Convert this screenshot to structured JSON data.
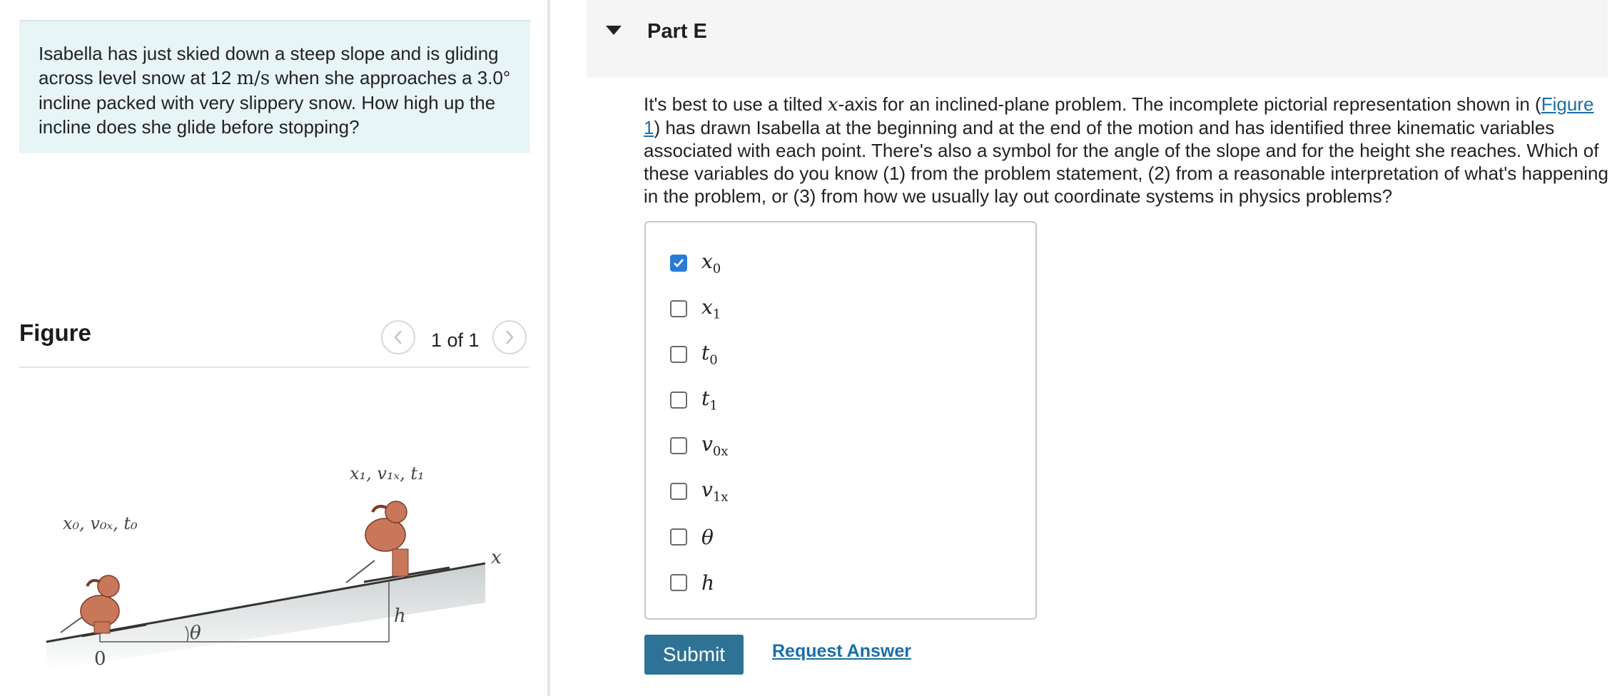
{
  "problem": {
    "text_1": "Isabella has just skied down a steep slope and is gliding across level snow at 12 ",
    "speed_unit": "m/s",
    "text_2": " when she approaches a ",
    "angle_value": "3.0°",
    "text_3": " incline packed with very slippery snow. How high up the incline does she glide before stopping?"
  },
  "figure": {
    "title": "Figure",
    "pager": "1 of 1",
    "labels": {
      "start_vars": "x₀, v₀ₓ, t₀",
      "end_vars": "x₁, v₁ₓ, t₁",
      "axis": "x",
      "origin": "0",
      "angle": "θ",
      "height": "h"
    }
  },
  "part": {
    "title": "Part E",
    "prompt_1": "It's best to use a tilted ",
    "prompt_x": "x",
    "prompt_2": "-axis for an inclined-plane problem. The incomplete pictorial representation shown in  (",
    "figure_link": "Figure 1",
    "prompt_3": ") has drawn Isabella at the beginning and at the end of the motion and has identified three kinematic variables associated with each point. There's also a symbol for the angle of the slope and for the height she reaches. Which of these variables do you know (1) from the problem statement, (2) from a reasonable interpretation of what's happening in the problem, or (3) from how we usually lay out coordinate systems in physics problems?"
  },
  "choices": [
    {
      "base": "x",
      "sub": "0",
      "checked": true
    },
    {
      "base": "x",
      "sub": "1",
      "checked": false
    },
    {
      "base": "t",
      "sub": "0",
      "checked": false
    },
    {
      "base": "t",
      "sub": "1",
      "checked": false
    },
    {
      "base": "v",
      "sub": "0x",
      "checked": false
    },
    {
      "base": "v",
      "sub": "1x",
      "checked": false
    },
    {
      "base": "θ",
      "sub": "",
      "checked": false
    },
    {
      "base": "h",
      "sub": "",
      "checked": false
    }
  ],
  "actions": {
    "submit": "Submit",
    "request_answer": "Request Answer"
  },
  "colors": {
    "problem_bg": "#e8f5f7",
    "checkbox_checked": "#2b7bd6",
    "submit_bg": "#2e7396",
    "link": "#1a6ea8",
    "skier": "#c8775a"
  }
}
